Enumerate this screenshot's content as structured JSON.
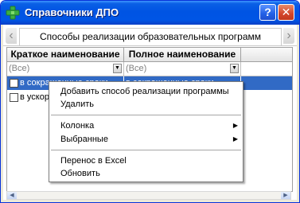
{
  "window": {
    "title": "Справочники ДПО"
  },
  "tab": {
    "title": "Способы реализации образовательных программ"
  },
  "grid": {
    "columns": [
      "Краткое наименование",
      "Полное наименование"
    ],
    "filter": [
      "(Все)",
      "(Все)"
    ],
    "rows": [
      {
        "short": "в сокращенные сроки",
        "full": "в сокращенные сроки",
        "selected": true
      },
      {
        "short": "в ускор",
        "full": "",
        "selected": false
      }
    ]
  },
  "context_menu": {
    "items": [
      {
        "label": "Добавить способ реализации программы",
        "has_submenu": false
      },
      {
        "label": "Удалить",
        "has_submenu": false
      },
      {
        "label": "Колонка",
        "has_submenu": true
      },
      {
        "label": "Выбранные",
        "has_submenu": true
      },
      {
        "label": "Перенос в Excel",
        "has_submenu": false
      },
      {
        "label": "Обновить",
        "has_submenu": false
      }
    ]
  },
  "colors": {
    "titlebar": "#0054e3",
    "selection": "#316ac5",
    "close_button": "#d3452a"
  },
  "icons": {
    "app": "green-cross-icon",
    "help": "help-icon",
    "close": "close-icon",
    "tab_left": "chevron-left-icon",
    "tab_right": "chevron-right-icon",
    "dropdown": "dropdown-arrow-icon",
    "submenu": "submenu-arrow-icon"
  }
}
